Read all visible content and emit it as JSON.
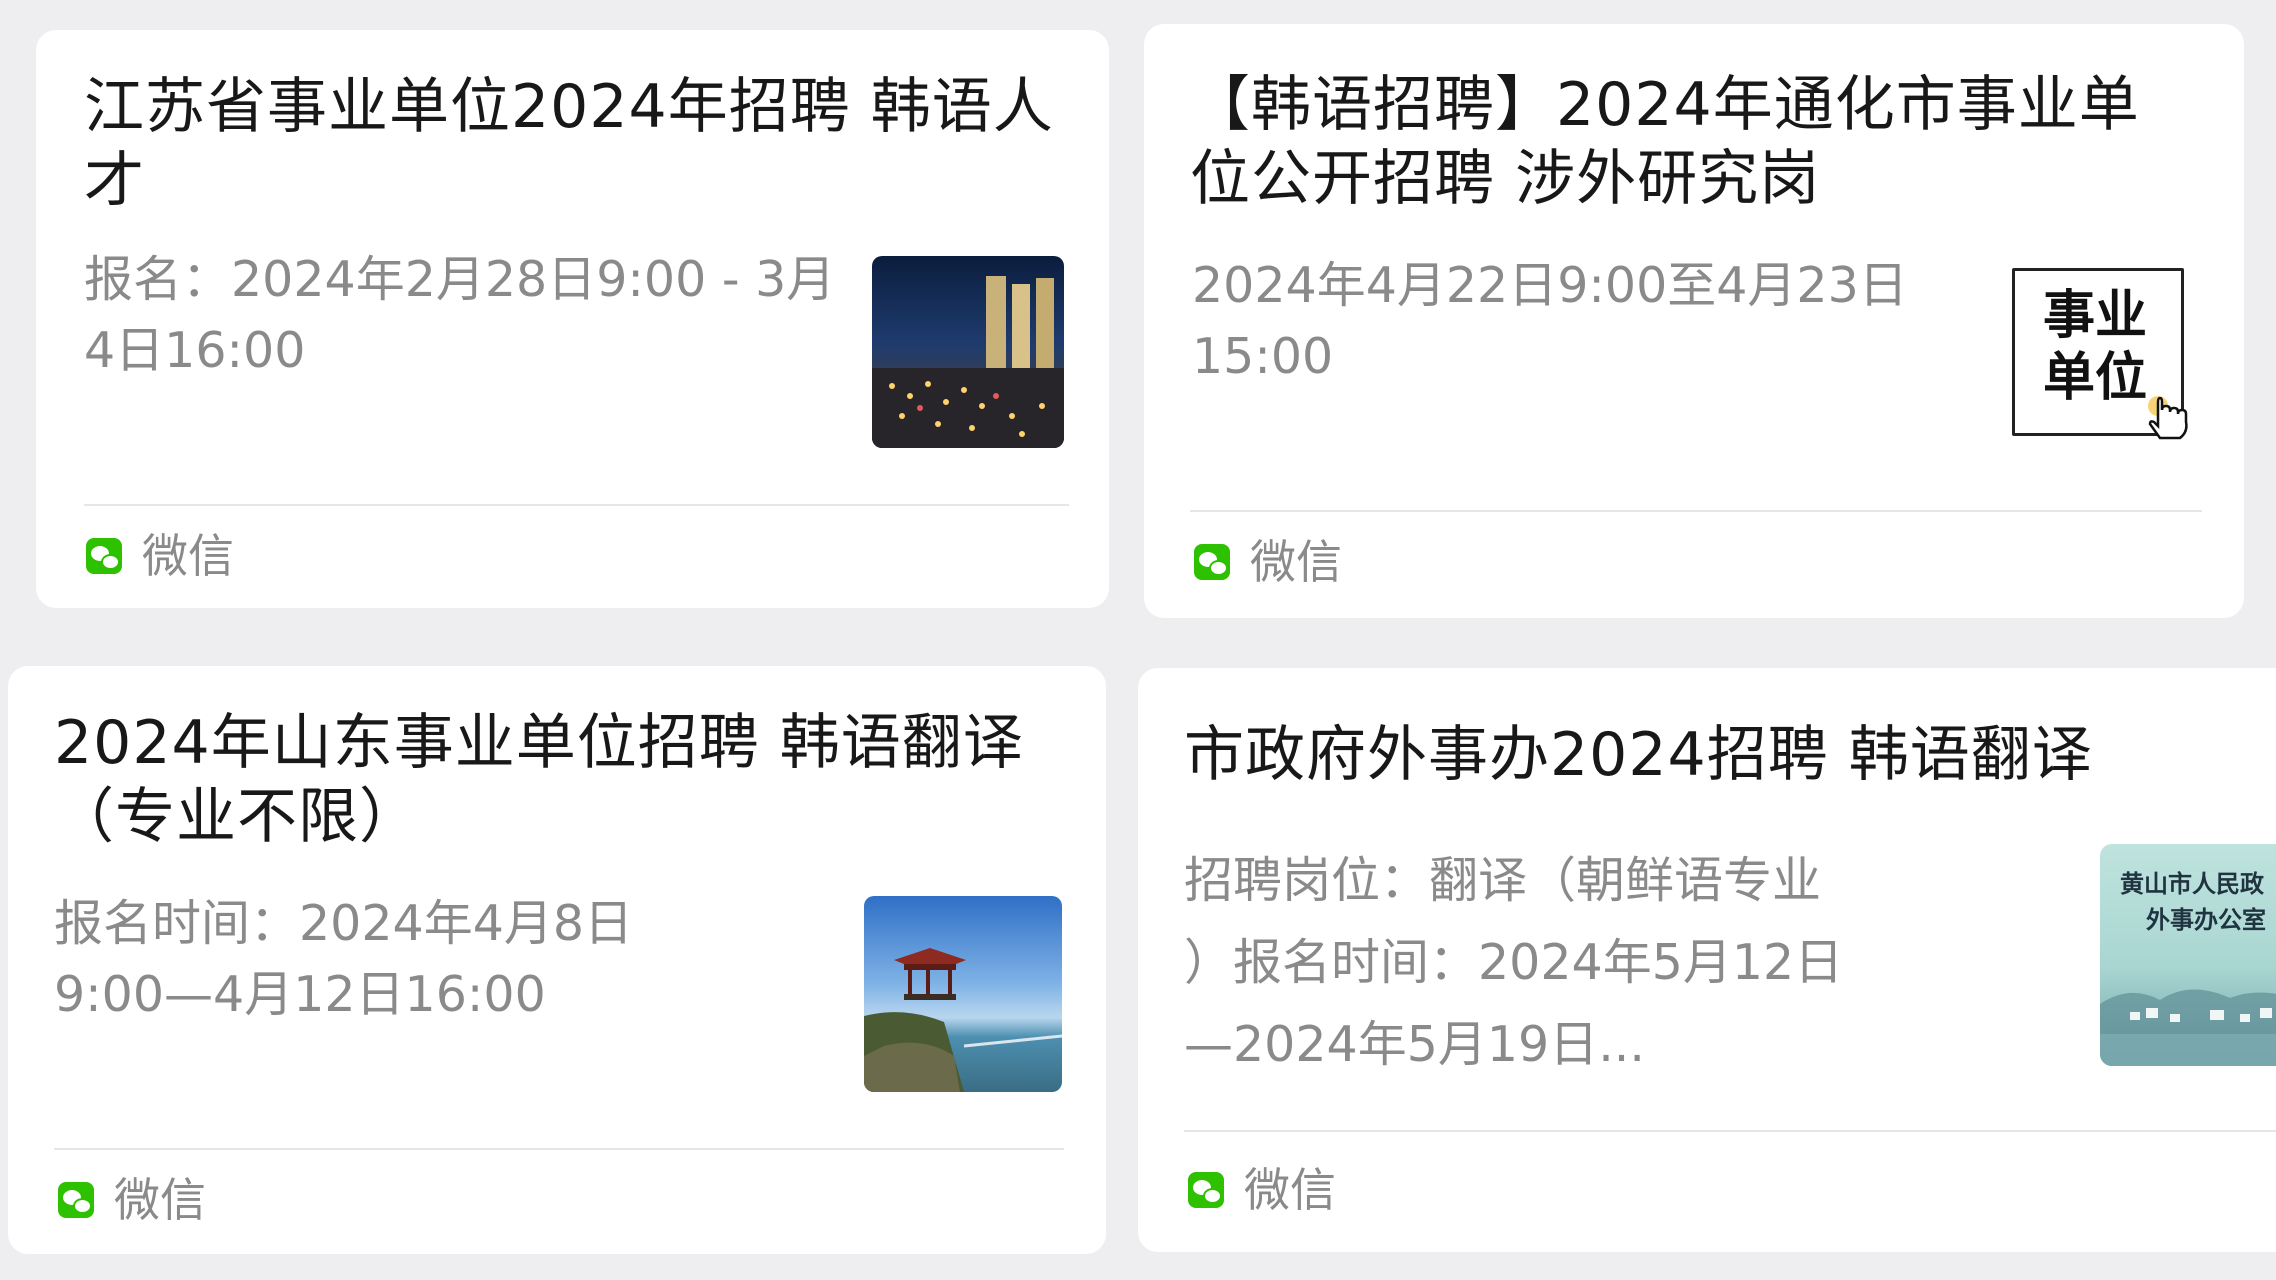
{
  "cards": [
    {
      "title_lines": [
        "江苏省事业单位2024年招聘 韩语人",
        "才"
      ],
      "desc_lines": [
        "报名：2024年2月28日9:00 - 3月",
        "4日16:00"
      ],
      "source": "微信",
      "thumb_icon": "night-city-icon"
    },
    {
      "title_lines": [
        "【韩语招聘】2024年通化市事业单",
        "位公开招聘 涉外研究岗"
      ],
      "desc_lines": [
        "2024年4月22日9:00至4月23日",
        "15:00"
      ],
      "source": "微信",
      "thumb_text_lines": [
        "事业",
        "单位"
      ],
      "thumb_icon": "hand-pointer-icon"
    },
    {
      "title_lines": [
        "2024年山东事业单位招聘 韩语翻译",
        "（专业不限）"
      ],
      "desc_lines": [
        "报名时间：2024年4月8日",
        "9:00—4月12日16:00"
      ],
      "source": "微信",
      "thumb_icon": "pavilion-seaside-icon"
    },
    {
      "title_lines": [
        "市政府外事办2024招聘 韩语翻译"
      ],
      "desc_lines": [
        "招聘岗位：翻译（朝鲜语专业",
        "）报名时间：2024年5月12日",
        "—2024年5月19日..."
      ],
      "source": "微信",
      "thumb_text_lines": [
        "黄山市人民政",
        "外事办公室"
      ],
      "thumb_icon": "landscape-icon"
    }
  ]
}
